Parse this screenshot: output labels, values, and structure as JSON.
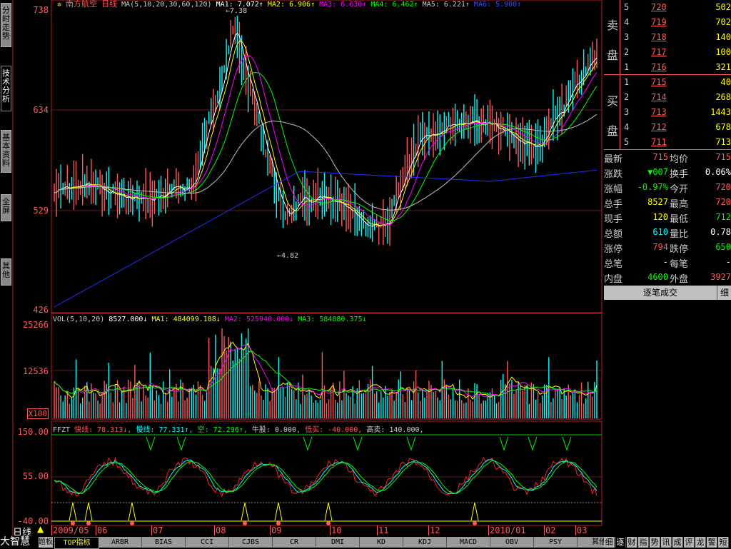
{
  "left_tabs": [
    "分时走势",
    "技术分析",
    "基本资料",
    "全屏",
    "其他"
  ],
  "left_tabs_active": 1,
  "header": {
    "stock": "南方航空",
    "period": "日线",
    "ma_label": "MA(5,10,20,30,60,120)",
    "ma1": "MA1: 7.072↑",
    "ma2": "MA2: 6.906↑",
    "ma3": "MA3: 6.630↑",
    "ma4": "MA4: 6.462↑",
    "ma5": "MA5: 6.221↑",
    "ma6": "MA6: 5.900↑"
  },
  "price_axis": [
    "738",
    "634",
    "529",
    "426"
  ],
  "annot_high": "7.38",
  "annot_low": "4.82",
  "vol_header": {
    "label": "VOL(5,10,20)",
    "vol": "8527.000↓",
    "ma1": "MA1: 484099.188↓",
    "ma2": "MA2: 525940.000↓",
    "ma3": "MA3: 584880.375↓"
  },
  "vol_axis": [
    "25266",
    "12536"
  ],
  "vol_unit": "X100",
  "ind_header": {
    "name": "FFZT",
    "fast": "快线: 78.313↓,",
    "slow": "慢线: 77.331↑,",
    "empty": "空: 72.296↑,",
    "bull": "牛股: 0.000,",
    "lowbuy": "低买: -40.000,",
    "highsell": "高卖: 140.000,"
  },
  "ind_axis": [
    "150.00",
    "55.00",
    "-40.00"
  ],
  "x_axis": {
    "period_label": "日线",
    "dates": [
      "2009/05",
      "06",
      "07",
      "08",
      "09",
      "10",
      "11",
      "12",
      "2010/01",
      "02",
      "03"
    ]
  },
  "panel": {
    "sell_label": [
      "卖",
      "盘"
    ],
    "buy_label": [
      "买",
      "盘"
    ],
    "sell": [
      {
        "lvl": "5",
        "price": "720",
        "vol": "502"
      },
      {
        "lvl": "4",
        "price": "719",
        "vol": "702"
      },
      {
        "lvl": "3",
        "price": "718",
        "vol": "140"
      },
      {
        "lvl": "2",
        "price": "717",
        "vol": "100"
      },
      {
        "lvl": "1",
        "price": "716",
        "vol": "321"
      }
    ],
    "buy": [
      {
        "lvl": "1",
        "price": "715",
        "vol": "40"
      },
      {
        "lvl": "2",
        "price": "714",
        "vol": "268"
      },
      {
        "lvl": "3",
        "price": "713",
        "vol": "1443"
      },
      {
        "lvl": "4",
        "price": "712",
        "vol": "678"
      },
      {
        "lvl": "5",
        "price": "711",
        "vol": "713"
      }
    ],
    "stats": [
      {
        "l1": "最新",
        "v1": "715",
        "c1": "#ff5a5a",
        "l2": "均价",
        "v2": "715",
        "c2": "#ff5a5a"
      },
      {
        "l1": "涨跌",
        "v1": "▼007",
        "c1": "#00ff00",
        "l2": "换手",
        "v2": "0.06%",
        "c2": "#ffffff"
      },
      {
        "l1": "涨幅",
        "v1": "-0.97%",
        "c1": "#00ff00",
        "l2": "今开",
        "v2": "720",
        "c2": "#ff5a5a"
      },
      {
        "l1": "总手",
        "v1": "8527",
        "c1": "#ffff00",
        "l2": "最高",
        "v2": "720",
        "c2": "#ff5a5a"
      },
      {
        "l1": "现手",
        "v1": "120",
        "c1": "#ffff00",
        "l2": "最低",
        "v2": "712",
        "c2": "#00ff00"
      },
      {
        "l1": "总额",
        "v1": "610",
        "c1": "#00ffff",
        "l2": "量比",
        "v2": "0.78",
        "c2": "#ffffff"
      },
      {
        "l1": "涨停",
        "v1": "794",
        "c1": "#ff5a5a",
        "l2": "跌停",
        "v2": "650",
        "c2": "#00ff00"
      },
      {
        "l1": "总笔",
        "v1": "-",
        "c1": "#ffffff",
        "l2": "每笔",
        "v2": "-",
        "c2": "#ffffff"
      },
      {
        "l1": "内盘",
        "v1": "4600",
        "c1": "#00ff00",
        "l2": "外盘",
        "v2": "3927",
        "c2": "#ff5a5a"
      }
    ],
    "tick_button": "逐笔成交",
    "detail_button": "细"
  },
  "bottom": {
    "brand": "大智慧",
    "board": "题板",
    "tabs": [
      "TOP指标",
      "ARBR",
      "BIAS",
      "CCI",
      "CJBS",
      "CR",
      "DMI",
      "KD",
      "KDJ",
      "MACD",
      "OBV",
      "PSY",
      "其他"
    ],
    "active_tab": 0,
    "right_tabs": [
      "细",
      "逐",
      "财",
      "指",
      "势",
      "讯",
      "成",
      "评",
      "龙",
      "警",
      "短"
    ],
    "right_active": 1
  },
  "colors": {
    "up": "#ff5a5a",
    "down": "#00ffff",
    "ma1": "#ffffff",
    "ma2": "#ffff00",
    "ma3": "#ff00ff",
    "ma4": "#00ff00",
    "ma5": "#c0c0c0",
    "ma6": "#0000ff"
  }
}
